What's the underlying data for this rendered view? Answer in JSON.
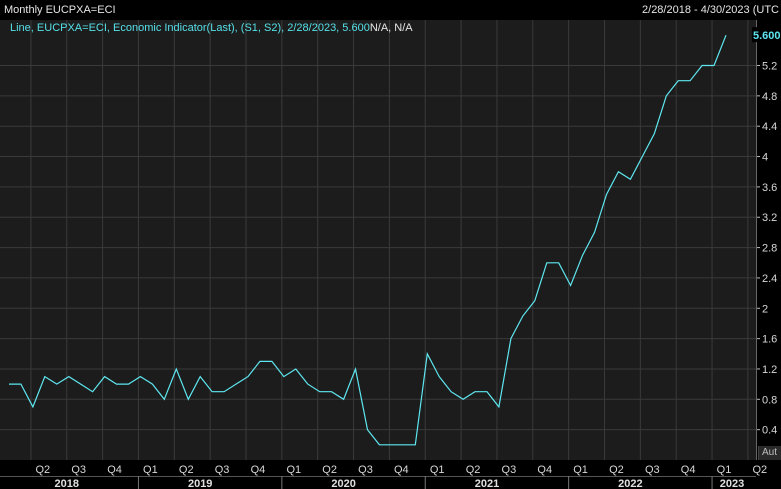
{
  "header": {
    "left": "Monthly EUCPXA=ECI",
    "right": "2/28/2018 - 4/30/2023 (UTC"
  },
  "legend": {
    "prefix": "Line, EUCPXA=ECI, Economic Indicator(Last), (S1, S2), 2/28/2023, 5.600",
    "suffix": "N/A, N/A"
  },
  "auto_label": "Aut",
  "colors": {
    "line": "#5ee7f0",
    "background": "#1c1c1c",
    "grid": "#3a3a3a"
  },
  "chart_data": {
    "type": "line",
    "ylim": [
      0.0,
      5.8
    ],
    "y_ticks": [
      "0.4",
      "0.8",
      "1.2",
      "1.6",
      "2",
      "2.4",
      "2.8",
      "3.2",
      "3.6",
      "4",
      "4.4",
      "4.8",
      "5.2"
    ],
    "last_value_label": "5.600",
    "quarter_labels": [
      "Q2",
      "Q3",
      "Q4",
      "Q1",
      "Q2",
      "Q3",
      "Q4",
      "Q1",
      "Q2",
      "Q3",
      "Q4",
      "Q1",
      "Q2",
      "Q3",
      "Q4",
      "Q1",
      "Q2",
      "Q3",
      "Q4",
      "Q1",
      "Q2"
    ],
    "year_labels": [
      "2018",
      "2019",
      "2020",
      "2021",
      "2022",
      "2023"
    ],
    "x": [
      "2018-02",
      "2018-03",
      "2018-04",
      "2018-05",
      "2018-06",
      "2018-07",
      "2018-08",
      "2018-09",
      "2018-10",
      "2018-11",
      "2018-12",
      "2019-01",
      "2019-02",
      "2019-03",
      "2019-04",
      "2019-05",
      "2019-06",
      "2019-07",
      "2019-08",
      "2019-09",
      "2019-10",
      "2019-11",
      "2019-12",
      "2020-01",
      "2020-02",
      "2020-03",
      "2020-04",
      "2020-05",
      "2020-06",
      "2020-07",
      "2020-08",
      "2020-09",
      "2020-10",
      "2020-11",
      "2020-12",
      "2021-01",
      "2021-02",
      "2021-03",
      "2021-04",
      "2021-05",
      "2021-06",
      "2021-07",
      "2021-08",
      "2021-09",
      "2021-10",
      "2021-11",
      "2021-12",
      "2022-01",
      "2022-02",
      "2022-03",
      "2022-04",
      "2022-05",
      "2022-06",
      "2022-07",
      "2022-08",
      "2022-09",
      "2022-10",
      "2022-11",
      "2022-12",
      "2023-01",
      "2023-02"
    ],
    "series": [
      {
        "values": [
          1.0,
          1.0,
          0.7,
          1.1,
          1.0,
          1.1,
          1.0,
          0.9,
          1.1,
          1.0,
          1.0,
          1.1,
          1.0,
          0.8,
          1.2,
          0.8,
          1.1,
          0.9,
          0.9,
          1.0,
          1.1,
          1.3,
          1.3,
          1.1,
          1.2,
          1.0,
          0.9,
          0.9,
          0.8,
          1.2,
          0.4,
          0.2,
          0.2,
          0.2,
          0.2,
          1.4,
          1.1,
          0.9,
          0.8,
          0.9,
          0.9,
          0.7,
          1.6,
          1.9,
          2.1,
          2.6,
          2.6,
          2.3,
          2.7,
          3.0,
          3.5,
          3.8,
          3.7,
          4.0,
          4.3,
          4.8,
          5.0,
          5.0,
          5.2,
          5.2,
          5.6
        ]
      }
    ]
  }
}
